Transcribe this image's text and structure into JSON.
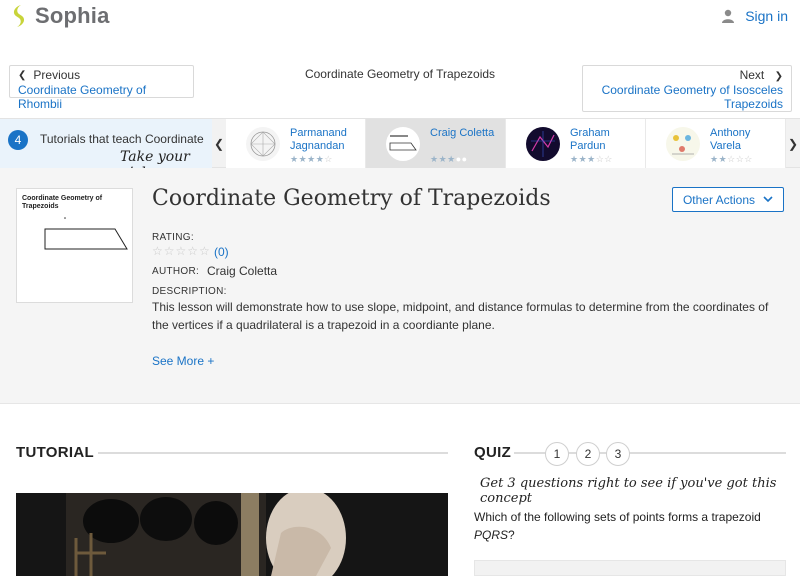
{
  "header": {
    "brand": "Sophia",
    "signin_label": "Sign in"
  },
  "nav": {
    "prev_label": "Previous",
    "prev_title": "Coordinate Geometry of Rhombii",
    "current_title": "Coordinate Geometry of Trapezoids",
    "next_label": "Next",
    "next_title": "Coordinate Geometry of Isosceles Trapezoids"
  },
  "tutorials_strip": {
    "count": "4",
    "intro_text": "Tutorials that teach Coordinate",
    "pick_text": "Take your pick:",
    "cards": [
      {
        "author": "Parmanand Jagnandan",
        "stars": 4
      },
      {
        "author": "Craig Coletta",
        "stars": 3
      },
      {
        "author": "Graham Pardun",
        "stars": 3
      },
      {
        "author": "Anthony Varela",
        "stars": 2
      }
    ]
  },
  "lesson": {
    "thumb_caption": "Coordinate Geometry of Trapezoids",
    "title": "Coordinate Geometry of Trapezoids",
    "other_actions_label": "Other Actions",
    "rating_label": "RATING:",
    "rating_count": "(0)",
    "author_label": "AUTHOR:",
    "author_name": "Craig Coletta",
    "description_label": "DESCRIPTION:",
    "description": "This lesson will demonstrate how to use slope, midpoint, and distance formulas to determine from the coordinates of the vertices if a quadrilateral is a trapezoid in a coordiante plane.",
    "see_more_label": "See More +"
  },
  "tutorial": {
    "heading": "TUTORIAL"
  },
  "quiz": {
    "heading": "QUIZ",
    "numbers": [
      "1",
      "2",
      "3"
    ],
    "tagline": "Get 3 questions right to see if you've got this concept",
    "question_text": "Which of the following sets of points forms a trapezoid",
    "question_var": "PQRS",
    "question_end": "?"
  },
  "colors": {
    "brand_yellow": "#c8d43a",
    "link_blue": "#1a73c6",
    "active_card": "#e1e1e1"
  }
}
